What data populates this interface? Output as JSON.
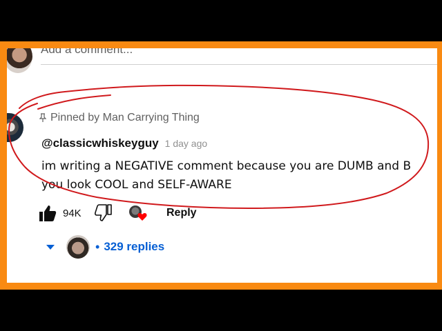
{
  "add_comment": {
    "placeholder": "Add a comment..."
  },
  "comment": {
    "pinned_label": "Pinned by Man Carrying Thing",
    "author": "@classicwhiskeyguy",
    "time_ago": "1 day ago",
    "text_line1": "im writing a NEGATIVE comment because you are DUMB and B",
    "text_line2": "you look COOL and SELF-AWARE",
    "like_count": "94K",
    "reply_label": "Reply",
    "replies_label": "329 replies",
    "replies_dot": "•"
  },
  "colors": {
    "frame": "#f98a12",
    "link_blue": "#065fd4",
    "scribble_red": "#d0191c",
    "heart_red": "#ff0000"
  },
  "icons": [
    "pin-icon",
    "like-icon",
    "dislike-icon",
    "heart-icon",
    "chevron-down-icon"
  ]
}
